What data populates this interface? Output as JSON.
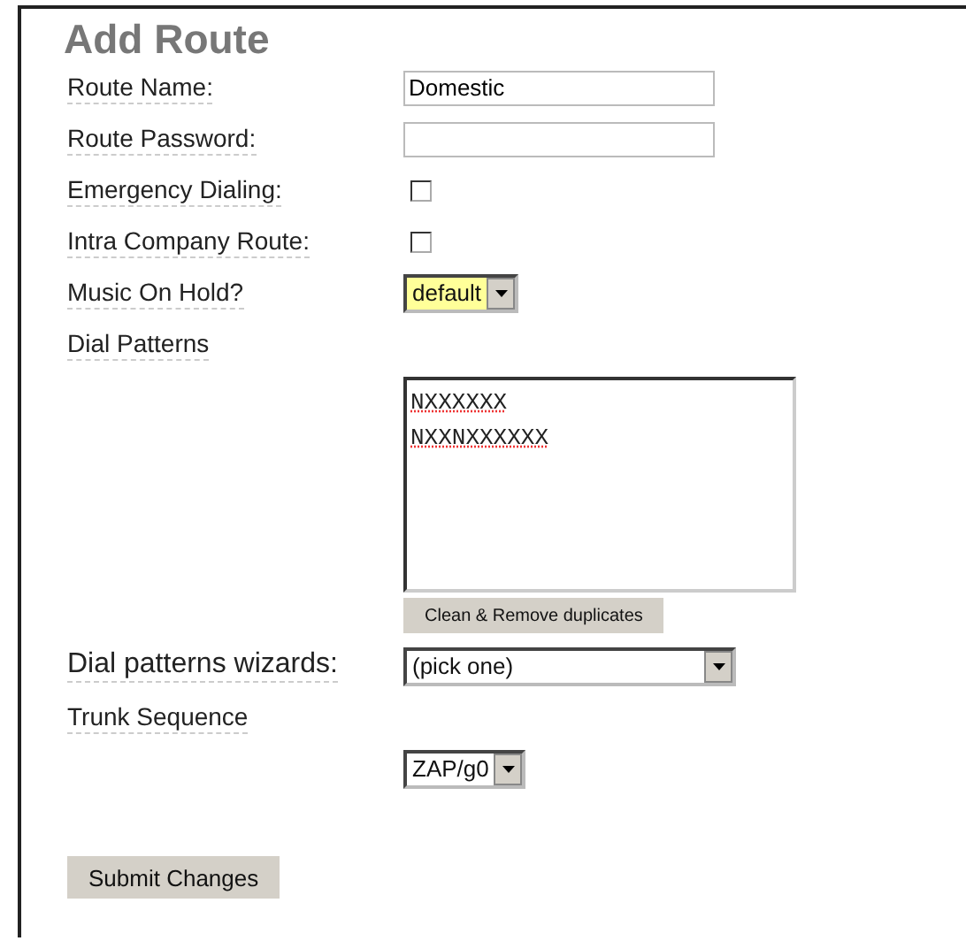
{
  "title": "Add Route",
  "fields": [
    {
      "kind": "text",
      "label": "Route Name:",
      "value": "Domestic"
    },
    {
      "kind": "text",
      "label": "Route Password:"
    },
    {
      "kind": "checkbox",
      "label": "Emergency Dialing:",
      "checked": false
    },
    {
      "kind": "checkbox",
      "label": "Intra Company Route:",
      "checked": false
    },
    {
      "kind": "select",
      "label": "Music On Hold?",
      "value": "default"
    }
  ],
  "dial_patterns": {
    "label": "Dial Patterns",
    "lines": [
      "NXXXXXX",
      "NXXNXXXXXX"
    ],
    "button": "Clean & Remove duplicates"
  },
  "wizard": {
    "label": "Dial patterns wizards:",
    "value": "(pick one)"
  },
  "trunk_sequence": {
    "label": "Trunk Sequence",
    "value": "ZAP/g0"
  },
  "submit": "Submit Changes"
}
